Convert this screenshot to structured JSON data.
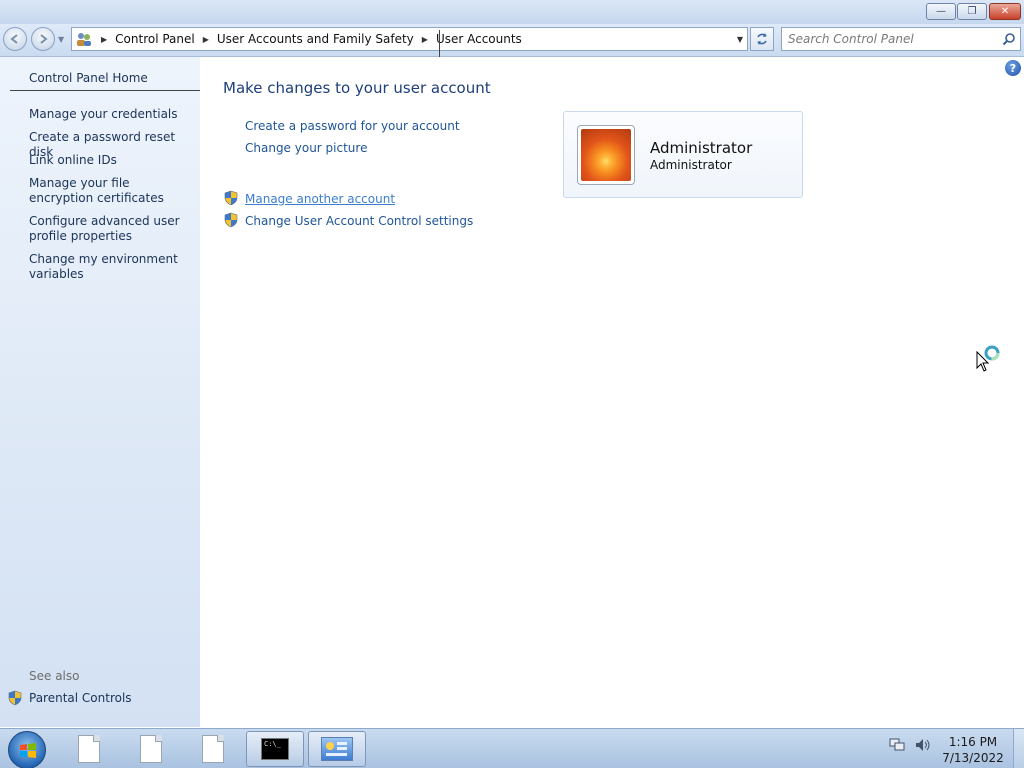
{
  "window": {
    "controls": {
      "minimize": "—",
      "maximize": "❐",
      "close": "✕"
    }
  },
  "navbar": {
    "breadcrumbs": [
      "Control Panel",
      "User Accounts and Family Safety",
      "User Accounts"
    ],
    "search_placeholder": "Search Control Panel"
  },
  "sidebar": {
    "home": "Control Panel Home",
    "links": [
      "Manage your credentials",
      "Create a password reset disk",
      "Link online IDs",
      "Manage your file encryption certificates",
      "Configure advanced user profile properties",
      "Change my environment variables"
    ],
    "see_also_label": "See also",
    "see_also": [
      "Parental Controls"
    ]
  },
  "main": {
    "help_glyph": "?",
    "heading": "Make changes to your user account",
    "tasks": [
      "Create a password for your account",
      "Change your picture"
    ],
    "admin_tasks": [
      "Manage another account",
      "Change User Account Control settings"
    ],
    "account": {
      "name": "Administrator",
      "type": "Administrator"
    }
  },
  "taskbar": {
    "cmd_text": "C:\\_",
    "clock": {
      "time": "1:16 PM",
      "date": "7/13/2022"
    }
  },
  "colors": {
    "link": "#1e5597",
    "sidebar_link": "#1b3356",
    "heading": "#1e3f7a",
    "sidebar_bg": "#dde8f6",
    "taskbar": "#a9c2e0"
  }
}
